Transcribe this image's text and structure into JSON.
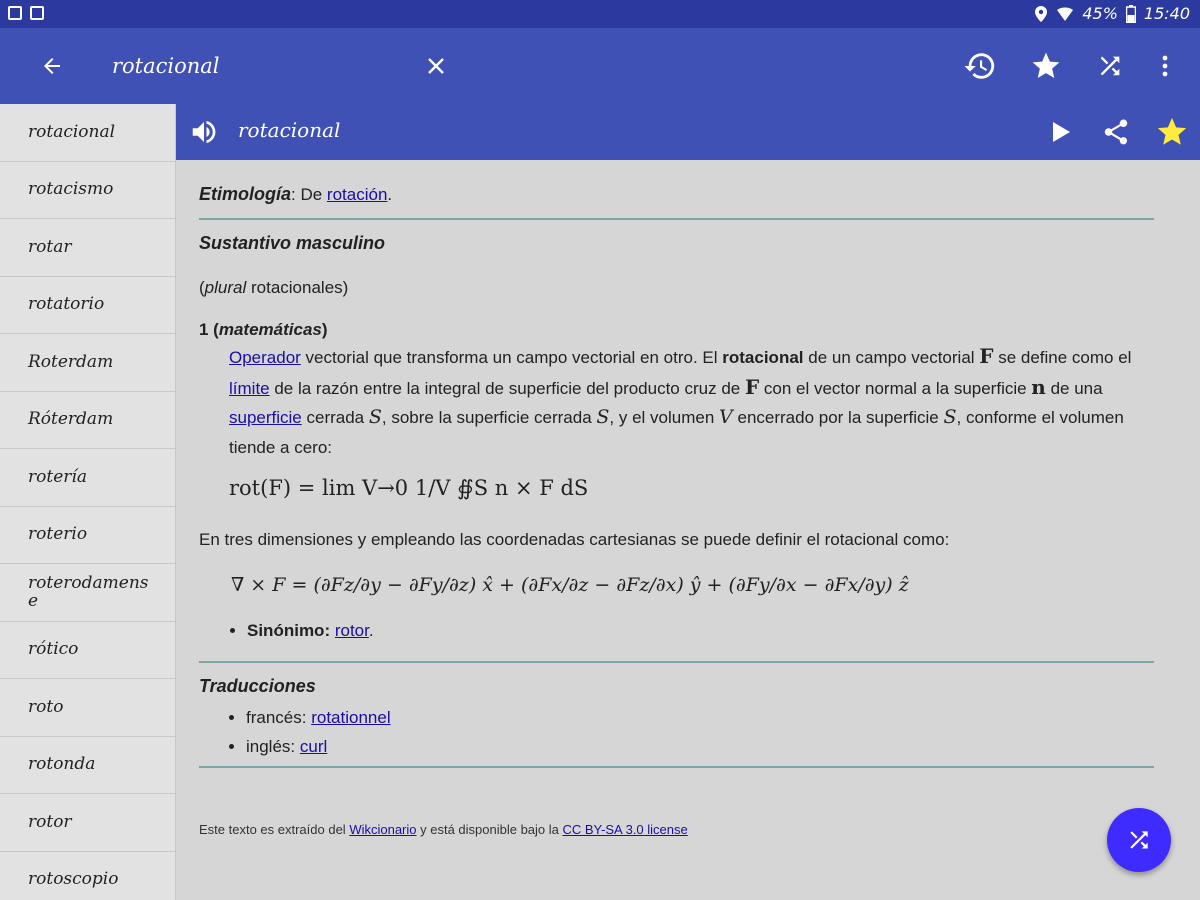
{
  "status": {
    "battery": "45%",
    "time": "15:40"
  },
  "toolbar": {
    "search_value": "rotacional"
  },
  "sidebar": {
    "items": [
      "rotacional",
      "rotacismo",
      "rotar",
      "rotatorio",
      "Roterdam",
      "Róterdam",
      "rotería",
      "roterio",
      "roterodamense",
      "rótico",
      "roto",
      "rotonda",
      "rotor",
      "rotoscopio"
    ]
  },
  "entry": {
    "title": "rotacional",
    "etym_label": "Etimología",
    "etym_text": ": De ",
    "etym_link": "rotación",
    "etym_end": ".",
    "pos": "Sustantivo masculino",
    "plural_open": "(",
    "plural_label": "plural",
    "plural_text": " rotacionales)",
    "sense_num": "1 (",
    "sense_label": "matemáticas",
    "sense_close": ")",
    "def_link1": "Operador",
    "def_t1": " vectorial que transforma un campo vectorial en otro. El ",
    "def_bold": "rotacional",
    "def_t2": " de un campo vectorial ",
    "F": "F",
    "def_t3": " se define como el ",
    "def_link2": "límite",
    "def_t4": " de la razón entre la integral de superficie del producto cruz de ",
    "def_t5": " con el vector normal a la superficie ",
    "n": "n",
    "def_t6": " de una ",
    "def_link3": "superficie",
    "def_t7": " cerrada ",
    "S": "S",
    "def_t8": ", sobre la superficie cerrada ",
    "def_t9": ", y el volumen ",
    "V": "V",
    "def_t10": "  encerrado por la superficie ",
    "def_t11": ", conforme el volumen tiende a cero:",
    "formula1": "rot(F) = lim V→0 1/V ∯S n × F dS",
    "sentence2": "En tres dimensiones y empleando las coordenadas cartesianas se puede definir el rotacional como:",
    "formula2": "∇ × F = (∂Fz/∂y − ∂Fy/∂z) x̂ + (∂Fx/∂z − ∂Fz/∂x) ŷ + (∂Fy/∂x − ∂Fx/∂y) ẑ",
    "syn_label": "Sinónimo:",
    "syn_link": "rotor",
    "syn_end": ".",
    "trans_heading": "Traducciones",
    "trans_fr_label": "francés: ",
    "trans_fr": "rotationnel",
    "trans_en_label": "inglés: ",
    "trans_en": "curl",
    "footer_t1": "Este texto es extraído del ",
    "footer_link1": "Wikcionario",
    "footer_t2": " y está disponible bajo la ",
    "footer_link2": "CC BY-SA 3.0 license"
  },
  "icons": [
    "back-arrow-icon",
    "clear-icon",
    "history-icon",
    "star-icon",
    "shuffle-icon",
    "more-vert-icon",
    "speaker-icon",
    "play-icon",
    "share-icon"
  ],
  "colors": {
    "toolbar": "#3f51b5",
    "statusbar": "#2c3aa0",
    "fab": "#3d2bff",
    "favorite_star": "#ffeb3b",
    "link": "#1a0dab"
  }
}
